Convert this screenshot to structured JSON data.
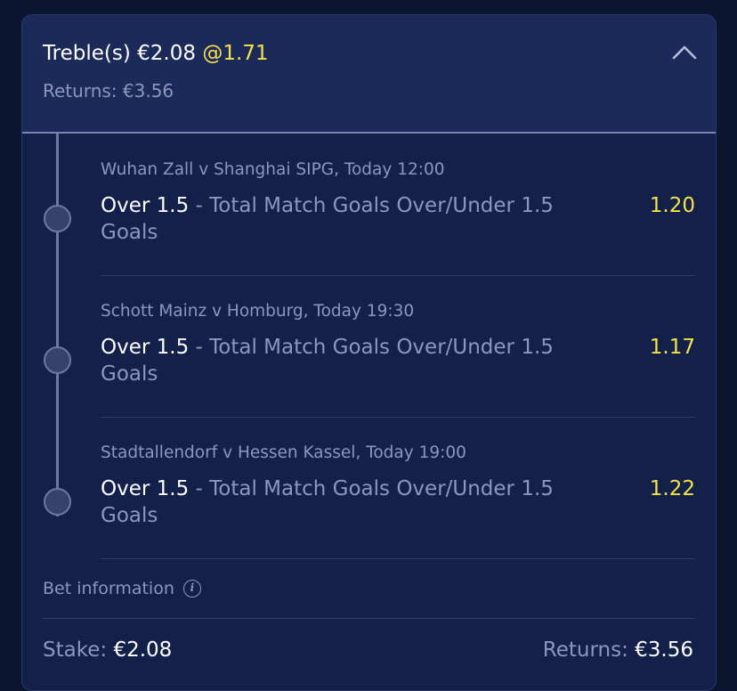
{
  "bet": {
    "type": "Treble(s)",
    "amount": "€2.08",
    "odds": "@1.71",
    "returns_label": "Returns:",
    "returns_value": "€3.56"
  },
  "legs": [
    {
      "match": "Wuhan Zall v Shanghai SIPG, Today 12:00",
      "pick": "Over 1.5",
      "separator": " - ",
      "market": "Total Match Goals Over/Under 1.5 Goals",
      "price": "1.20"
    },
    {
      "match": "Schott Mainz v Homburg, Today 19:30",
      "pick": "Over 1.5",
      "separator": " - ",
      "market": "Total Match Goals Over/Under 1.5 Goals",
      "price": "1.17"
    },
    {
      "match": "Stadtallendorf v Hessen Kassel, Today 19:00",
      "pick": "Over 1.5",
      "separator": " - ",
      "market": "Total Match Goals Over/Under 1.5 Goals",
      "price": "1.22"
    }
  ],
  "footer": {
    "bet_info_label": "Bet information",
    "info_glyph": "i",
    "stake_label": "Stake:",
    "stake_value": "€2.08",
    "returns_label": "Returns:",
    "returns_value": "€3.56"
  },
  "icons": {
    "collapse": "chevron-up-icon",
    "info": "info-icon"
  },
  "colors": {
    "background": "#0b1530",
    "card": "#13204a",
    "header": "#1c2a5a",
    "odds_yellow": "#f5e14a",
    "muted_text": "#8c97bd",
    "primary_text": "#ffffff"
  }
}
